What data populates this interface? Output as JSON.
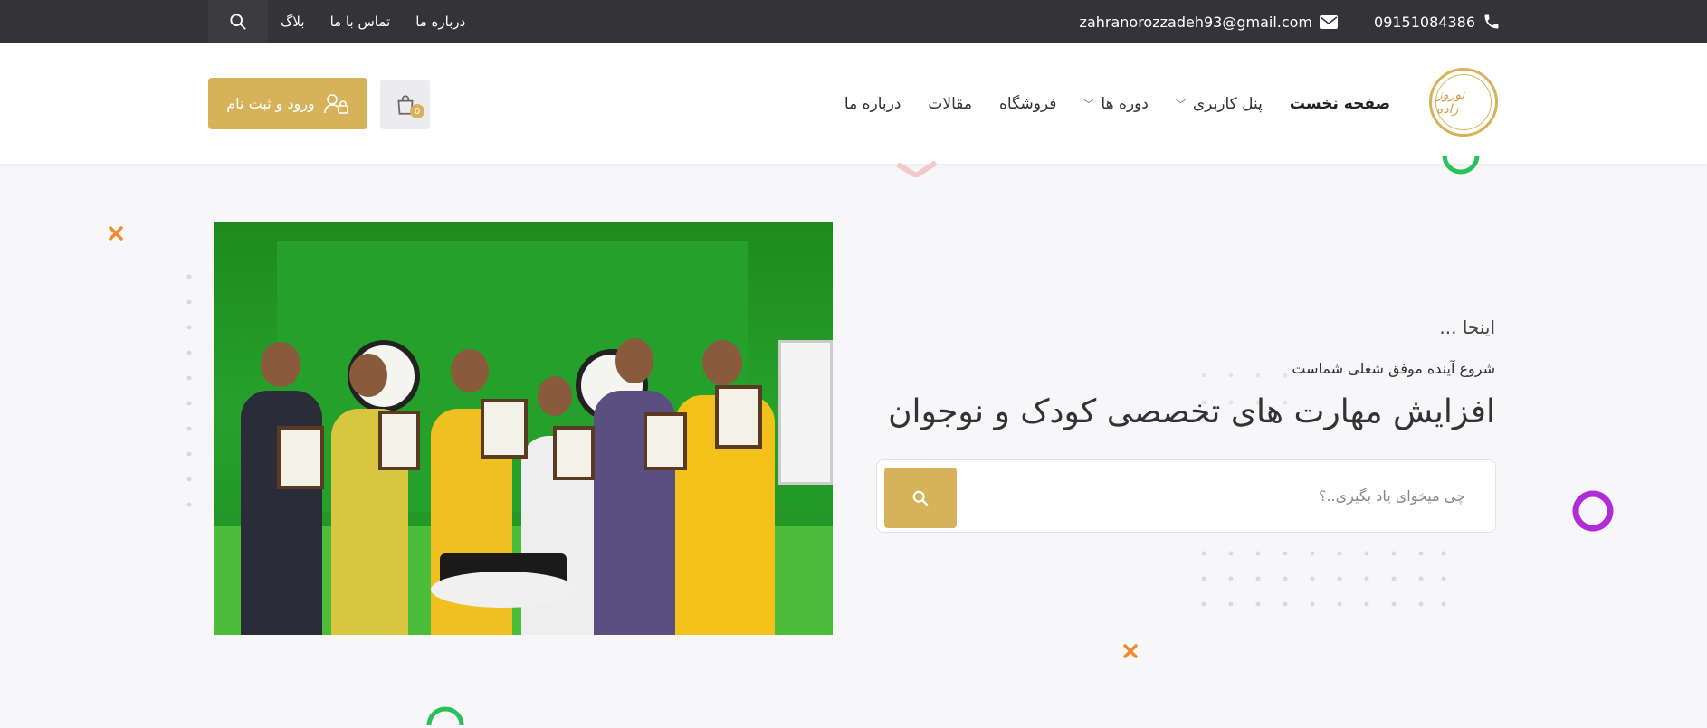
{
  "topbar": {
    "links": [
      "بلاگ",
      "تماس با ما",
      "درباره ما"
    ],
    "email": "zahranorozzadeh93@gmail.com",
    "phone": "09151084386"
  },
  "header": {
    "logo_text": "نوروز زاده",
    "nav": [
      {
        "label": "صفحه نخست",
        "active": true,
        "dropdown": false
      },
      {
        "label": "پنل کاربری",
        "active": false,
        "dropdown": true
      },
      {
        "label": "دوره ها",
        "active": false,
        "dropdown": true
      },
      {
        "label": "فروشگاه",
        "active": false,
        "dropdown": false
      },
      {
        "label": "مقالات",
        "active": false,
        "dropdown": false
      },
      {
        "label": "درباره ما",
        "active": false,
        "dropdown": false
      }
    ],
    "cart_count": "0",
    "login_label": "ورود و ثبت نام"
  },
  "hero": {
    "kicker": "اینجا ...",
    "subtitle": "شروع آینده موفق شغلی شماست",
    "title": "افزایش مهارت های تخصصی کودک و نوجوان",
    "search_placeholder": "چی میخوای یاد بگیری..؟"
  },
  "colors": {
    "accent": "#d6b35a",
    "topbar": "#343338",
    "purple": "#b12bd6",
    "green": "#2bc15a",
    "orange": "#f08a2c"
  }
}
